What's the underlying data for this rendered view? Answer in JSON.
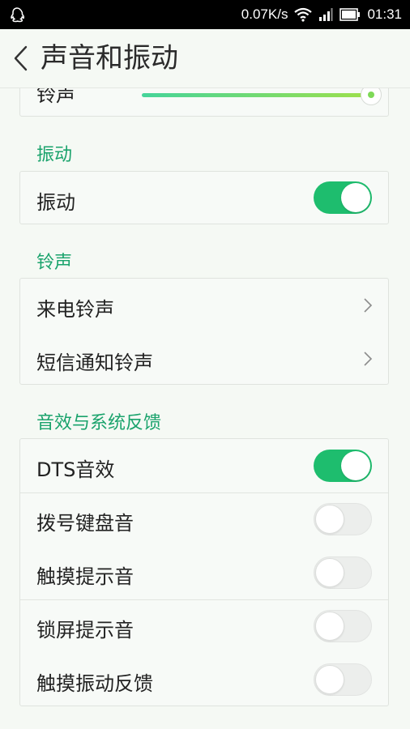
{
  "status_bar": {
    "speed": "0.07K/s",
    "time": "01:31",
    "icons": [
      "qq-icon",
      "wifi-icon",
      "signal-icon",
      "battery-icon"
    ]
  },
  "header": {
    "title": "声音和振动",
    "back_icon": "chevron-left-icon"
  },
  "ringtone_volume": {
    "label": "铃声",
    "level": 0.96
  },
  "sections": {
    "vibration": {
      "title": "振动",
      "vibrate_label": "振动",
      "vibrate_on": true
    },
    "ringtones": {
      "title": "铃声",
      "incoming_call": "来电铃声",
      "sms_notification": "短信通知铃声"
    },
    "effects": {
      "title": "音效与系统反馈",
      "items": [
        {
          "label": "DTS音效",
          "on": true
        },
        {
          "label": "拨号键盘音",
          "on": false
        },
        {
          "label": "触摸提示音",
          "on": false
        },
        {
          "label": "锁屏提示音",
          "on": false
        },
        {
          "label": "触摸振动反馈",
          "on": false
        }
      ]
    }
  },
  "colors": {
    "accent": "#1ebd6e",
    "section_header": "#1aa36c"
  }
}
